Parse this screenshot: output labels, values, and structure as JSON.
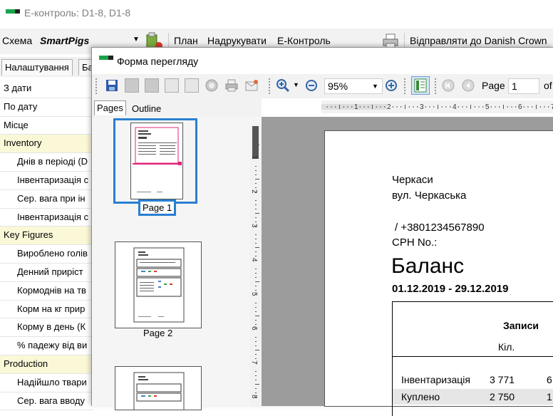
{
  "main": {
    "title": "E-контроль: D1-8, D1-8",
    "toolbar": {
      "scheme_label": "Схема",
      "scheme_value": "SmartPigs",
      "plan": "План",
      "print": "Надрукувати",
      "econtrol": "E-Контроль",
      "send": "Відправляти до Danish Crown"
    },
    "tabs": [
      "Налаштування",
      "Ба"
    ],
    "grid_rows": [
      {
        "text": "З дати",
        "type": "plain"
      },
      {
        "text": "По дату",
        "type": "plain"
      },
      {
        "text": "Місце",
        "type": "plain"
      },
      {
        "text": "Inventory",
        "type": "cat"
      },
      {
        "text": "Днів в періоді (D",
        "type": "sub"
      },
      {
        "text": "Інвентаризація с",
        "type": "sub"
      },
      {
        "text": "Сер. вага при ін",
        "type": "sub"
      },
      {
        "text": "Інвентаризація с",
        "type": "sub"
      },
      {
        "text": "Key Figures",
        "type": "cat"
      },
      {
        "text": "Вироблено голів",
        "type": "sub"
      },
      {
        "text": "Денний приріст",
        "type": "sub"
      },
      {
        "text": "Кормоднів на тв",
        "type": "sub"
      },
      {
        "text": "Корм на кг прир",
        "type": "sub"
      },
      {
        "text": "Корму в день (К",
        "type": "sub"
      },
      {
        "text": "% падежу від ви",
        "type": "sub"
      },
      {
        "text": "Production",
        "type": "cat"
      },
      {
        "text": "Надійшло твари",
        "type": "sub"
      },
      {
        "text": "Сер. вага вводу",
        "type": "sub"
      }
    ]
  },
  "preview": {
    "title": "Форма перегляду",
    "zoom": "95%",
    "page_label": "Page",
    "page_value": "1",
    "of_label": "of",
    "tabs": {
      "pages": "Pages",
      "outline": "Outline"
    },
    "thumb_labels": [
      "Page 1",
      "Page 2"
    ],
    "ruler_top": [
      "1",
      "2",
      "3",
      "4",
      "5",
      "6",
      "7"
    ],
    "ruler_left": [
      "1",
      "2",
      "3",
      "4",
      "5",
      "6",
      "7",
      "8"
    ],
    "document": {
      "city": "Черкаси",
      "street": "вул. Черкаська",
      "phone": "/ +3801234567890",
      "cph": "CPH No.:",
      "heading": "Баланс",
      "period": "01.12.2019 - 29.12.2019",
      "col_header": "Записи",
      "sub_header": "Кіл.",
      "rows": [
        {
          "label": "Інвентаризація",
          "qty": "3 771",
          "next": "6"
        },
        {
          "label": "Куплено",
          "qty": "2 750",
          "next": "1"
        }
      ]
    }
  },
  "colors": {
    "accent": "#2a7fd1",
    "category_bg": "#fbf8d8",
    "logo_green": "#1aa34a"
  }
}
